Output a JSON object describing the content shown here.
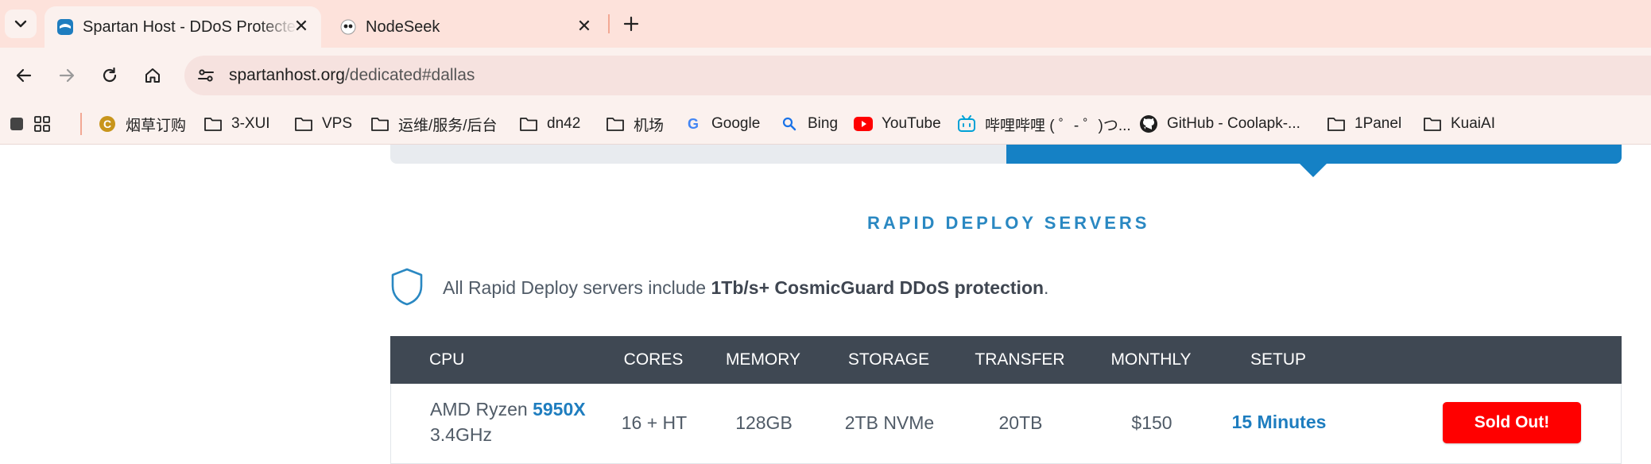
{
  "browser": {
    "tabs": [
      {
        "title": "Spartan Host - DDoS Protected",
        "active": true
      },
      {
        "title": "NodeSeek",
        "active": false
      }
    ],
    "url": {
      "host": "spartanhost.org",
      "path": "/dedicated#dallas"
    },
    "bookmarks": [
      {
        "label": "烟草订购",
        "icon": "smoke-icon"
      },
      {
        "label": "3-XUI",
        "icon": "folder-icon"
      },
      {
        "label": "VPS",
        "icon": "folder-icon"
      },
      {
        "label": "运维/服务/后台",
        "icon": "folder-icon"
      },
      {
        "label": "dn42",
        "icon": "folder-icon"
      },
      {
        "label": "机场",
        "icon": "folder-icon"
      },
      {
        "label": "Google",
        "icon": "google-icon"
      },
      {
        "label": "Bing",
        "icon": "bing-icon"
      },
      {
        "label": "YouTube",
        "icon": "youtube-icon"
      },
      {
        "label": "哔哩哔哩 ( ゜- ゜)つ...",
        "icon": "bilibili-icon"
      },
      {
        "label": "GitHub - Coolapk-...",
        "icon": "github-icon"
      },
      {
        "label": "1Panel",
        "icon": "folder-icon"
      },
      {
        "label": "KuaiAI",
        "icon": "folder-icon"
      }
    ]
  },
  "page": {
    "section_title": "RAPID DEPLOY SERVERS",
    "notice": {
      "prefix": "All Rapid Deploy servers include ",
      "strong": "1Tb/s+ CosmicGuard DDoS protection",
      "suffix": "."
    },
    "table": {
      "headers": {
        "cpu": "CPU",
        "cores": "CORES",
        "memory": "MEMORY",
        "storage": "STORAGE",
        "transfer": "TRANSFER",
        "monthly": "MONTHLY",
        "setup": "SETUP"
      },
      "rows": [
        {
          "cpu_brand": "AMD Ryzen ",
          "cpu_model": "5950X",
          "cpu_clock": "3.4GHz",
          "cores": "16 + HT",
          "memory": "128GB",
          "storage": "2TB NVMe",
          "transfer": "20TB",
          "monthly": "$150",
          "setup": "15 Minutes",
          "action": "Sold Out!"
        }
      ]
    }
  },
  "colors": {
    "accent": "#1e7dbf",
    "header_bg": "#3f4853",
    "soldout": "#ff0000",
    "tabstrip": "#fde2db"
  }
}
